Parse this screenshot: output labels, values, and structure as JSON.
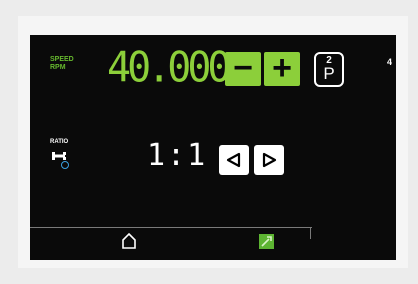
{
  "speed": {
    "label_line1": "SPEED",
    "label_line2": "RPM",
    "value": "40.000"
  },
  "buttons": {
    "minus": "−",
    "plus": "+",
    "program_sup": "2",
    "program_main": "P"
  },
  "channel": "4",
  "ratio": {
    "label": "RATIO",
    "value": "1:1"
  },
  "colors": {
    "accent_green": "#8ccf3a",
    "screen_bg": "#0a0a0a",
    "ratio_dot_blue": "#3aa0e0"
  },
  "icons": {
    "ratio": "wrench-icon",
    "left": "triangle-left-icon",
    "right": "triangle-right-icon",
    "home": "home-icon",
    "tool": "green-tool-icon"
  }
}
